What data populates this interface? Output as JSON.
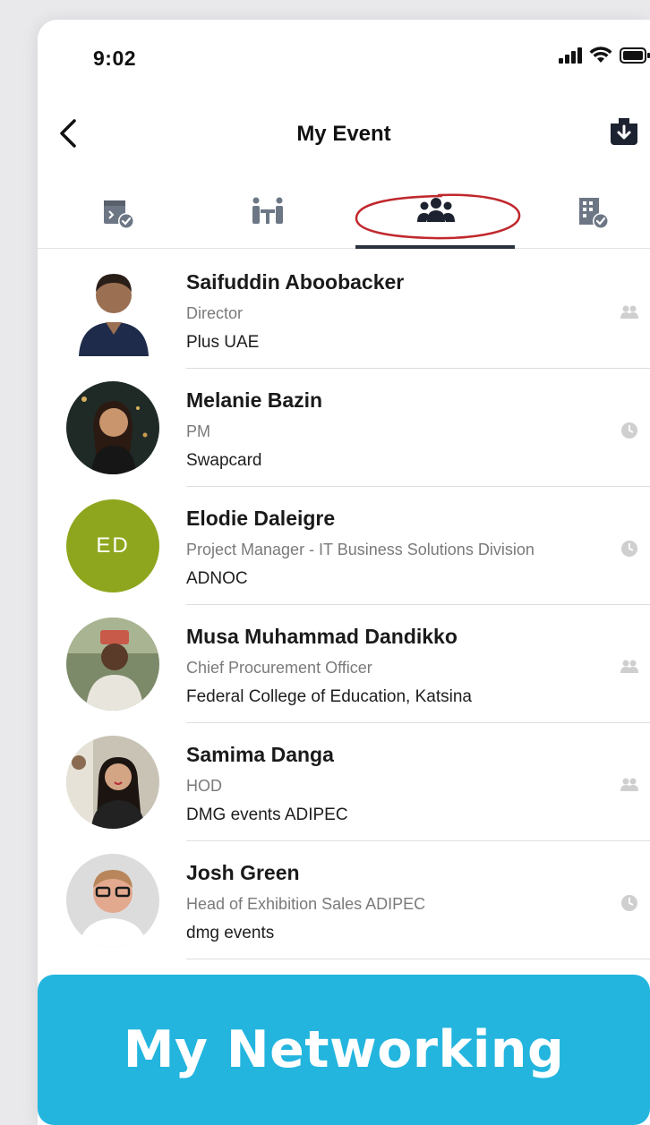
{
  "status_bar": {
    "time": "9:02",
    "icons": [
      "cellular-signal-icon",
      "wifi-icon",
      "battery-icon"
    ]
  },
  "nav": {
    "title": "My Event",
    "back_icon": "chevron-left-icon",
    "download_icon": "download-icon"
  },
  "tabs": [
    {
      "name": "tab-calendar",
      "icon": "calendar-check-icon",
      "selected": false
    },
    {
      "name": "tab-meetings",
      "icon": "meeting-table-icon",
      "selected": false
    },
    {
      "name": "tab-networking",
      "icon": "people-group-icon",
      "selected": true
    },
    {
      "name": "tab-exhibitors",
      "icon": "building-check-icon",
      "selected": false
    }
  ],
  "contacts": [
    {
      "name": "Saifuddin Aboobacker",
      "title": "Director",
      "company": "Plus UAE",
      "status": "people-icon"
    },
    {
      "name": "Melanie Bazin",
      "title": "PM",
      "company": "Swapcard",
      "status": "clock-icon"
    },
    {
      "name": "Elodie Daleigre",
      "title": "Project Manager - IT Business Solutions Division",
      "company": "ADNOC",
      "initials": "ED",
      "status": "clock-icon"
    },
    {
      "name": "Musa Muhammad Dandikko",
      "title": "Chief Procurement Officer",
      "company": "Federal College of Education, Katsina",
      "status": "people-icon"
    },
    {
      "name": "Samima Danga",
      "title": "HOD",
      "company": "DMG events ADIPEC",
      "status": "people-icon"
    },
    {
      "name": "Josh Green",
      "title": "Head of Exhibition Sales ADIPEC",
      "company": "dmg events",
      "status": "clock-icon"
    }
  ],
  "banner": {
    "text": "My Networking"
  },
  "colors": {
    "accent": "#23b5de",
    "tab_indicator": "#2c3140",
    "annotation": "#c0282d",
    "initials_bg": "#8ea61d"
  }
}
